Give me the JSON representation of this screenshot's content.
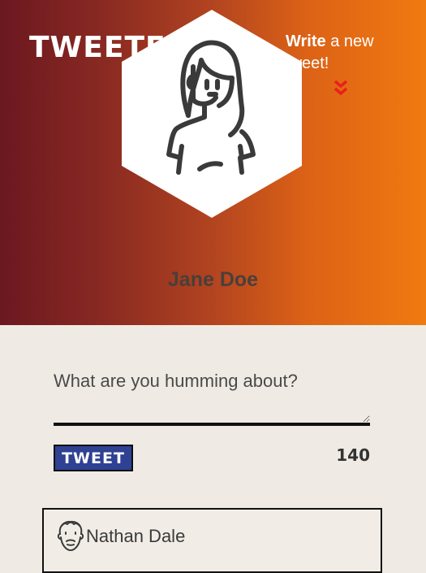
{
  "brand": {
    "logo_text": "TWEETER"
  },
  "hero": {
    "cta_bold": "Write",
    "cta_rest": " a new tweet!",
    "chevron_icon": "double-chevron-down-icon",
    "chevron_color": "#e8201a",
    "gradient_colors": [
      "#6b1820",
      "#f07a10"
    ]
  },
  "profile": {
    "avatar_icon": "user-avatar-icon",
    "name": "Jane Doe"
  },
  "composer": {
    "placeholder": "What are you humming about?",
    "value": "",
    "tweet_button_label": "TWEET",
    "char_count": "140",
    "button_color": "#2e4192"
  },
  "feed": {
    "items": [
      {
        "avatar_icon": "bearded-man-avatar-icon",
        "name": "Nathan Dale"
      }
    ]
  }
}
